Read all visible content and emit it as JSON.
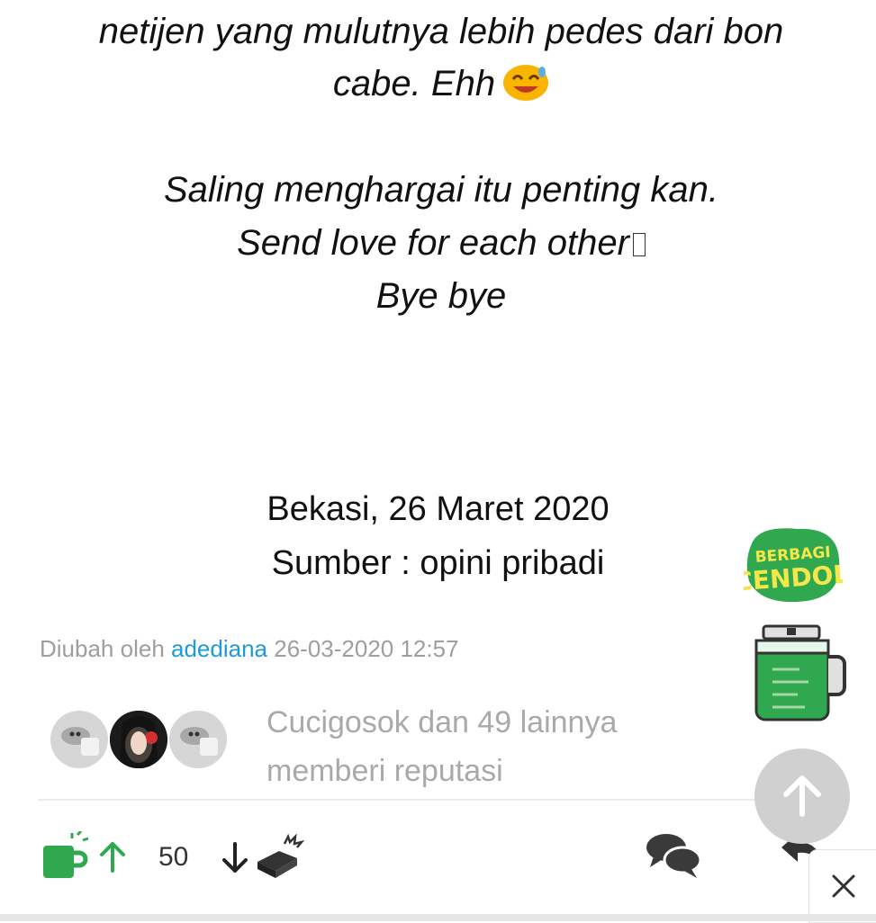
{
  "post": {
    "line1": "netijen yang mulutnya lebih pedes dari bon",
    "line2": "cabe. Ehh",
    "line3": "Saling menghargai itu penting kan.",
    "line4": "Send love for each other",
    "line5": "Bye bye",
    "location_date": "Bekasi, 26 Maret 2020",
    "source": "Sumber : opini pribadi"
  },
  "edit_info": {
    "prefix": "Diubah oleh",
    "user": "adediana",
    "timestamp": "26-03-2020 12:57"
  },
  "reputation": {
    "line1": "Cucigosok dan 49 lainnya",
    "line2": "memberi reputasi"
  },
  "actions": {
    "vote_count": "50"
  },
  "widgets": {
    "cendol_line1": "BERBAGI",
    "cendol_line2": "CENDOL"
  },
  "icons": {
    "emoji": "grinning-face-emoji",
    "cendol": "cendol-cup-icon",
    "upvote": "arrow-up-icon",
    "downvote": "arrow-down-icon",
    "bata": "brick-icon",
    "comments": "comments-icon",
    "reply": "reply-icon",
    "scroll_top": "arrow-up-icon",
    "close": "close-icon"
  },
  "colors": {
    "accent_green": "#2fa84f",
    "link_blue": "#1e9bd7",
    "muted_text": "#a9a9a9"
  }
}
